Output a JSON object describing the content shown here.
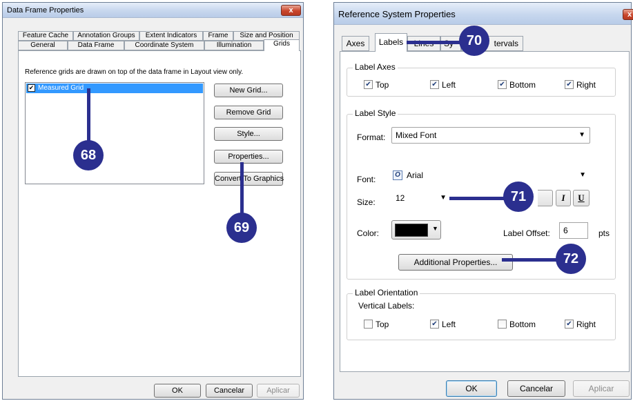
{
  "left_dialog": {
    "title": "Data Frame Properties",
    "close_label": "x",
    "tabs_row1": [
      "Feature Cache",
      "Annotation Groups",
      "Extent Indicators",
      "Frame",
      "Size and Position"
    ],
    "tabs_row2": [
      "General",
      "Data Frame",
      "Coordinate System",
      "Illumination",
      "Grids"
    ],
    "active_tab": "Grids",
    "description": "Reference grids are drawn on top of the data frame in Layout view only.",
    "grid_list": [
      {
        "label": "Measured Grid",
        "checked": true,
        "selected": true
      }
    ],
    "buttons": {
      "new_grid": "New Grid...",
      "remove_grid": "Remove Grid",
      "style": "Style...",
      "properties": "Properties...",
      "convert": "Convert To Graphics"
    },
    "footer": {
      "ok": "OK",
      "cancel": "Cancelar",
      "apply": "Aplicar"
    }
  },
  "right_dialog": {
    "title": "Reference System Properties",
    "close_label": "x",
    "tabs": [
      "Axes",
      "Labels",
      "Lines",
      "Sy",
      "tervals"
    ],
    "active_tab": "Labels",
    "label_axes": {
      "legend": "Label Axes",
      "items": [
        {
          "label": "Top",
          "checked": true
        },
        {
          "label": "Left",
          "checked": true
        },
        {
          "label": "Bottom",
          "checked": true
        },
        {
          "label": "Right",
          "checked": true
        }
      ]
    },
    "label_style": {
      "legend": "Label Style",
      "format_label": "Format:",
      "format_value": "Mixed Font",
      "font_label": "Font:",
      "font_value": "Arial",
      "font_icon_glyph": "O",
      "size_label": "Size:",
      "size_value": "12",
      "italic_label": "I",
      "underline_label": "U",
      "color_label": "Color:",
      "color_value": "#000000",
      "offset_label": "Label Offset:",
      "offset_value": "6",
      "offset_unit": "pts",
      "additional_button": "Additional Properties..."
    },
    "label_orientation": {
      "legend": "Label Orientation",
      "vertical_label": "Vertical Labels:",
      "items": [
        {
          "label": "Top",
          "checked": false
        },
        {
          "label": "Left",
          "checked": true
        },
        {
          "label": "Bottom",
          "checked": false
        },
        {
          "label": "Right",
          "checked": true
        }
      ]
    },
    "footer": {
      "ok": "OK",
      "cancel": "Cancelar",
      "apply": "Aplicar"
    }
  },
  "callouts": [
    "68",
    "69",
    "70",
    "71",
    "72"
  ],
  "colors": {
    "callout": "#2b2f8f",
    "selection": "#3399ff"
  }
}
